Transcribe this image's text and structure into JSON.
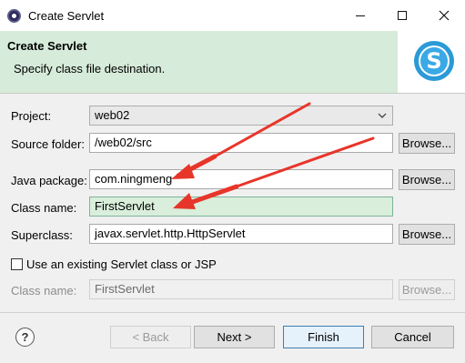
{
  "window": {
    "title": "Create Servlet"
  },
  "banner": {
    "title": "Create Servlet",
    "description": "Specify class file destination."
  },
  "form": {
    "project": {
      "label": "Project:",
      "value": "web02"
    },
    "source_folder": {
      "label": "Source folder:",
      "value": "/web02/src",
      "browse": "Browse..."
    },
    "java_package": {
      "label": "Java package:",
      "value": "com.ningmeng",
      "browse": "Browse..."
    },
    "class_name": {
      "label": "Class name:",
      "value": "FirstServlet"
    },
    "superclass": {
      "label": "Superclass:",
      "value": "javax.servlet.http.HttpServlet",
      "browse": "Browse..."
    },
    "existing_servlet": {
      "label": "Use an existing Servlet class or JSP",
      "checked": false
    },
    "existing_class_name": {
      "label": "Class name:",
      "value": "FirstServlet",
      "browse": "Browse..."
    }
  },
  "buttons": {
    "help": "?",
    "back": "< Back",
    "next": "Next >",
    "finish": "Finish",
    "cancel": "Cancel"
  },
  "colors": {
    "banner_green": "#d6ebd9",
    "highlight_field": "#d9eedb",
    "annotation_arrow": "#e8352a",
    "logo_blue": "#2a9ad8"
  }
}
